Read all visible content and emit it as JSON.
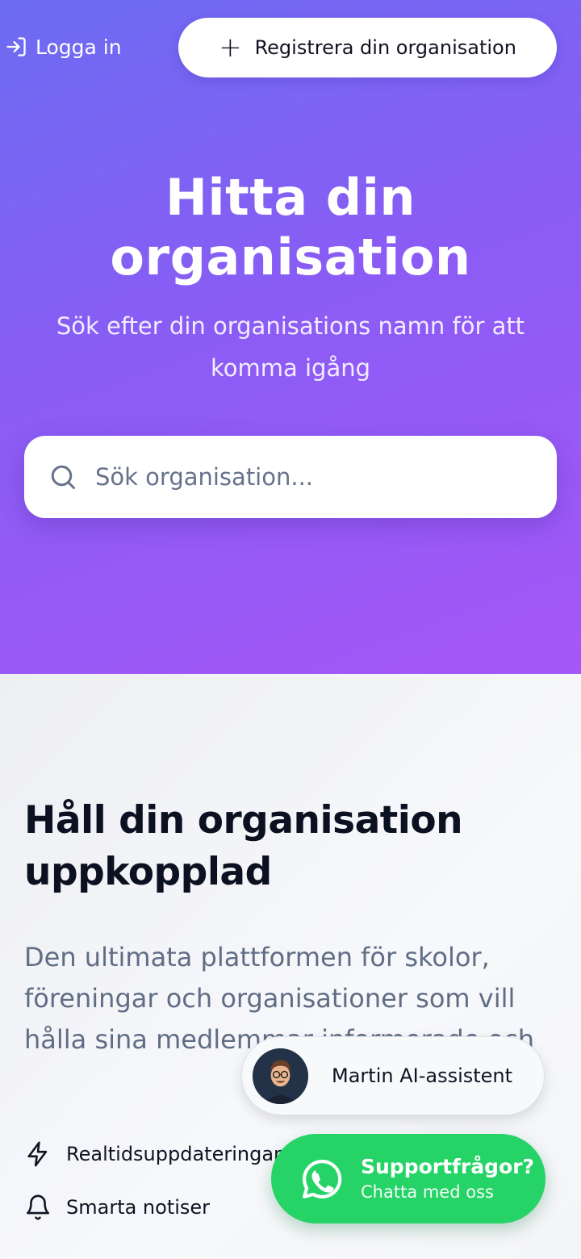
{
  "header": {
    "login_label": "Logga in",
    "register_label": "Registrera din organisation"
  },
  "hero": {
    "title": "Hitta din organisation",
    "subtitle": "Sök efter din organisations namn för att komma igång",
    "search_placeholder": "Sök organisation..."
  },
  "info": {
    "title": "Håll din organisation uppkopplad",
    "text": "Den ultimata plattformen för skolor, föreningar och organisationer som vill hålla sina medlemmar informerade och",
    "features": [
      {
        "icon": "lightning-icon",
        "label": "Realtidsuppdateringar"
      },
      {
        "icon": "bell-icon",
        "label": "Smarta notiser"
      }
    ]
  },
  "assistant": {
    "label": "Martin AI-assistent"
  },
  "support": {
    "title": "Supportfrågor?",
    "subtitle": "Chatta med oss"
  },
  "colors": {
    "hero_gradient_start": "#6c6cf2",
    "hero_gradient_end": "#a557f7",
    "whatsapp_green": "#25d366",
    "heading": "#0b1120",
    "body_text": "#5f6d85"
  }
}
